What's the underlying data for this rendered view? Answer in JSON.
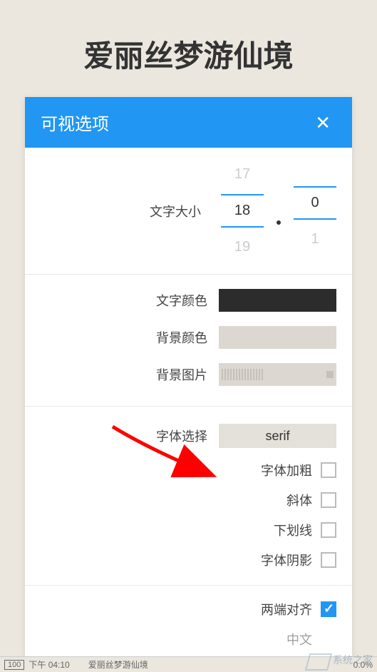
{
  "page": {
    "title": "爱丽丝梦游仙境"
  },
  "dialog": {
    "title": "可视选项",
    "close": "✕",
    "textSize": {
      "label": "文字大小",
      "major": {
        "prev": "17",
        "value": "18",
        "next": "19"
      },
      "minor": {
        "prev": "",
        "value": "0",
        "next": "1"
      }
    },
    "colors": {
      "textColorLabel": "文字颜色",
      "textColor": "#2c2c2c",
      "bgColorLabel": "背景颜色",
      "bgColor": "#dcd8d1",
      "bgImageLabel": "背景图片"
    },
    "font": {
      "selectLabel": "字体选择",
      "selectValue": "serif",
      "bold": {
        "label": "字体加粗",
        "checked": false
      },
      "italic": {
        "label": "斜体",
        "checked": false
      },
      "underline": {
        "label": "下划线",
        "checked": false
      },
      "shadow": {
        "label": "字体阴影",
        "checked": false
      }
    },
    "align": {
      "justify": {
        "label": "两端对齐",
        "checked": true
      },
      "chinese": {
        "label": "中文"
      }
    }
  },
  "statusBar": {
    "battery": "100",
    "time": "下午 04:10",
    "bookTitle": "爱丽丝梦游仙境",
    "percent": "0.0%"
  },
  "watermark": {
    "text": "系统之家"
  }
}
